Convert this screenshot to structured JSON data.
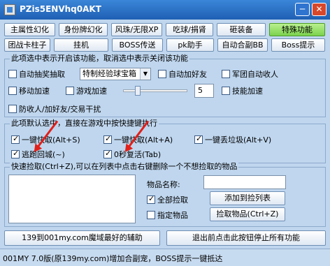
{
  "window": {
    "title": "PZis5ENVhq0AKT",
    "min_glyph": "─",
    "close_glyph": "✕"
  },
  "tabs": [
    {
      "label": "主属性幻化"
    },
    {
      "label": "身份牌幻化"
    },
    {
      "label": "风珠/无限XP"
    },
    {
      "label": "吃球/捐肾"
    },
    {
      "label": "砸装备"
    },
    {
      "label": "特殊功能"
    },
    {
      "label": "团战卡柱子"
    },
    {
      "label": "挂机"
    },
    {
      "label": "BOSS传送"
    },
    {
      "label": "pk助手"
    },
    {
      "label": "自动合副BB"
    },
    {
      "label": "Boss提示"
    }
  ],
  "section1": {
    "title": "此项选中表示开启该功能，取消选中表示关闭该功能",
    "auto_lottery": "自动抽奖抽取",
    "exp_select": "特制经验球宝箱",
    "auto_friend": "自动加好友",
    "auto_join_team": "军团自动收人",
    "move_speed": "移动加速",
    "game_speed": "游戏加速",
    "speed_value": "5",
    "skill_speed": "技能加速",
    "anti_team": "防收人/加好友/交易干扰"
  },
  "section2": {
    "title": "此项默认选中，直接在游戏中按快捷键执行",
    "pick_weapon": "一键快取(Alt+S)",
    "pick_material": "一键快取(Alt+A)",
    "throw_junk": "一键丢垃圾(Alt+V)",
    "escape": "逃跑回城(~)",
    "revive": "0秒复活(Tab)"
  },
  "section3": {
    "title": "快速捡取(Ctrl+Z),可以在列表中点击右键删除一个不想捡取的物品",
    "item_name_label": "物品名称:",
    "item_name_value": "",
    "add_to_list": "添加到捡列表",
    "all_pick": "全部捡取",
    "pick_items_btn": "捡取物品(Ctrl+Z)",
    "specified_items": "指定物品"
  },
  "buttons": {
    "helper": "139到001my.com魔域最好的辅助",
    "exit_stop": "退出前点击此按钮停止所有功能"
  },
  "status": "001MY 7.0版(原139my.com)增加合副宠，BOSS提示一键抵达",
  "colors": {
    "active_tab": "#7bd24d",
    "title_bar": "#2b6fc6",
    "arrow": "#e0201a"
  }
}
